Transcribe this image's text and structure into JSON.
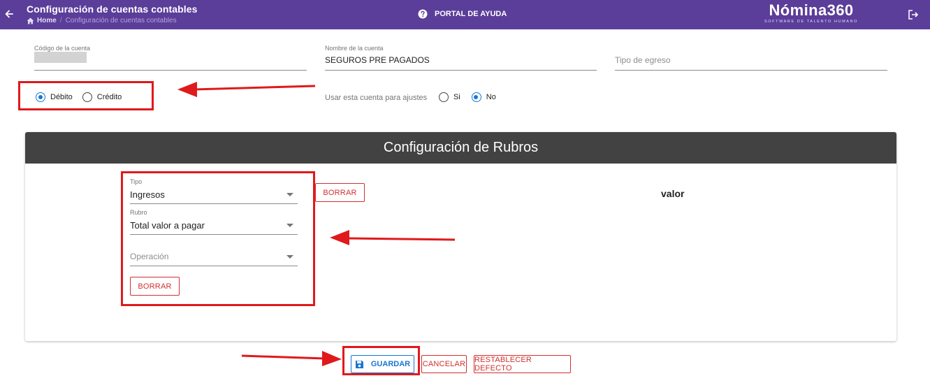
{
  "header": {
    "title": "Configuración de cuentas contables",
    "breadcrumb_home": "Home",
    "breadcrumb_current": "Configuración de cuentas contables",
    "help_label": "PORTAL DE AYUDA",
    "logo_main": "Nómina360",
    "logo_sub": "SOFTWARE DE TALENTO HUMANO",
    "icons": {
      "back": "arrow-left-icon",
      "home": "home-icon",
      "help": "help-circle-icon",
      "logout": "logout-icon"
    }
  },
  "form": {
    "codigo_label": "Código de la cuenta",
    "codigo_value": "",
    "nombre_label": "Nombre de la cuenta",
    "nombre_value": "SEGUROS PRE PAGADOS",
    "tipo_egreso_placeholder": "Tipo de egreso",
    "naturaleza": [
      {
        "label": "Débito",
        "selected": true
      },
      {
        "label": "Crédito",
        "selected": false
      }
    ],
    "ajustes_label": "Usar esta cuenta para ajustes",
    "ajustes": [
      {
        "label": "Si",
        "selected": false
      },
      {
        "label": "No",
        "selected": true
      }
    ]
  },
  "rubros": {
    "title": "Configuración de Rubros",
    "tipo_label": "Tipo",
    "tipo_value": "Ingresos",
    "rubro_label": "Rubro",
    "rubro_value": "Total valor a pagar",
    "operacion_placeholder": "Operación",
    "borrar_top": "BORRAR",
    "borrar_bottom": "BORRAR",
    "valor_label": "valor"
  },
  "actions": {
    "guardar": "GUARDAR",
    "cancelar": "CANCELAR",
    "restablecer": "RESTABLECER DEFECTO",
    "save_icon": "floppy-disk-icon"
  },
  "colors": {
    "topbar": "#5b3d9a",
    "primary": "#1976d2",
    "danger": "#d32f2f",
    "card_header": "#424242",
    "annotation": "#e0191c"
  }
}
